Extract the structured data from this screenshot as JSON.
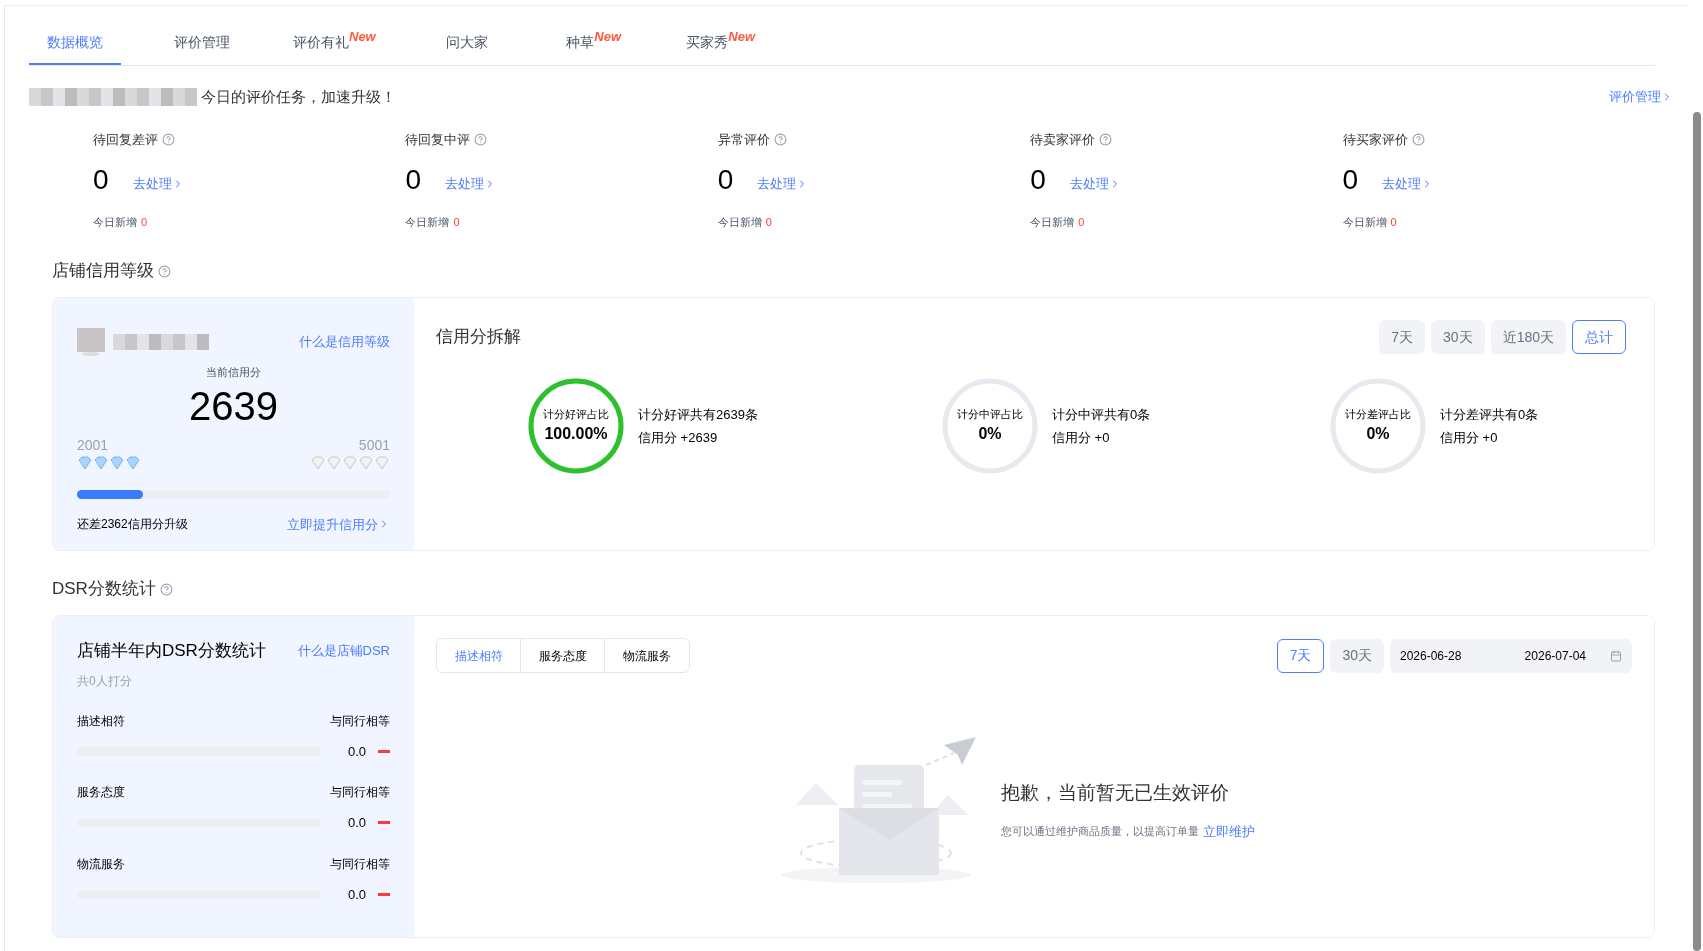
{
  "tabs": [
    {
      "label": "数据概览",
      "selected": true
    },
    {
      "label": "评价管理",
      "selected": false
    },
    {
      "label": "评价有礼",
      "badge": "New",
      "selected": false
    },
    {
      "label": "问大家",
      "selected": false
    },
    {
      "label": "种草",
      "badge": "New",
      "selected": false
    },
    {
      "label": "买家秀",
      "badge": "New",
      "selected": false
    }
  ],
  "banner": {
    "text": "今日的评价任务，加速升级！",
    "link": "评价管理"
  },
  "metrics": [
    {
      "title": "待回复差评",
      "value": "0",
      "action": "去处理",
      "today_label": "今日新增",
      "today_value": "0"
    },
    {
      "title": "待回复中评",
      "value": "0",
      "action": "去处理",
      "today_label": "今日新增",
      "today_value": "0"
    },
    {
      "title": "异常评价",
      "value": "0",
      "action": "去处理",
      "today_label": "今日新增",
      "today_value": "0"
    },
    {
      "title": "待卖家评价",
      "value": "0",
      "action": "去处理",
      "today_label": "今日新增",
      "today_value": "0"
    },
    {
      "title": "待买家评价",
      "value": "0",
      "action": "去处理",
      "today_label": "今日新增",
      "today_value": "0"
    }
  ],
  "credit": {
    "section_title": "店铺信用等级",
    "help_link": "什么是信用等级",
    "score_label": "当前信用分",
    "score": "2639",
    "range_min": "2001",
    "range_max": "5001",
    "level": 0.21,
    "gap_text": "还差2362信用分升级",
    "upgrade_link": "立即提升信用分"
  },
  "breakdown": {
    "title": "信用分拆解",
    "periods": [
      {
        "label": "7天",
        "selected": false
      },
      {
        "label": "30天",
        "selected": false
      },
      {
        "label": "近180天",
        "selected": false
      },
      {
        "label": "总计",
        "selected": true
      }
    ],
    "items": [
      {
        "ring_label": "计分好评占比",
        "percent": "100.00%",
        "count_text": "计分好评共有2639条",
        "score_text": "信用分 +2639"
      },
      {
        "ring_label": "计分中评占比",
        "percent": "0%",
        "count_text": "计分中评共有0条",
        "score_text": "信用分 +0"
      },
      {
        "ring_label": "计分差评占比",
        "percent": "0%",
        "count_text": "计分差评共有0条",
        "score_text": "信用分 +0"
      }
    ]
  },
  "dsr": {
    "section_title": "DSR分数统计",
    "card_title": "店铺半年内DSR分数统计",
    "help_link": "什么是店铺DSR",
    "raters": "共0人打分",
    "rows": [
      {
        "label": "描述相符",
        "compare": "与同行相等",
        "value": "0.0"
      },
      {
        "label": "服务态度",
        "compare": "与同行相等",
        "value": "0.0"
      },
      {
        "label": "物流服务",
        "compare": "与同行相等",
        "value": "0.0"
      }
    ],
    "tabs": [
      {
        "label": "描述相符",
        "selected": true
      },
      {
        "label": "服务态度",
        "selected": false
      },
      {
        "label": "物流服务",
        "selected": false
      }
    ],
    "periods": [
      {
        "label": "7天",
        "selected": true
      },
      {
        "label": "30天",
        "selected": false
      }
    ],
    "date_start": "2026-06-28",
    "date_end": "2026-07-04",
    "empty_title": "抱歉，当前暂无已生效评价",
    "empty_text": "您可以通过维护商品质量，以提高订单量",
    "empty_link": "立即维护"
  }
}
